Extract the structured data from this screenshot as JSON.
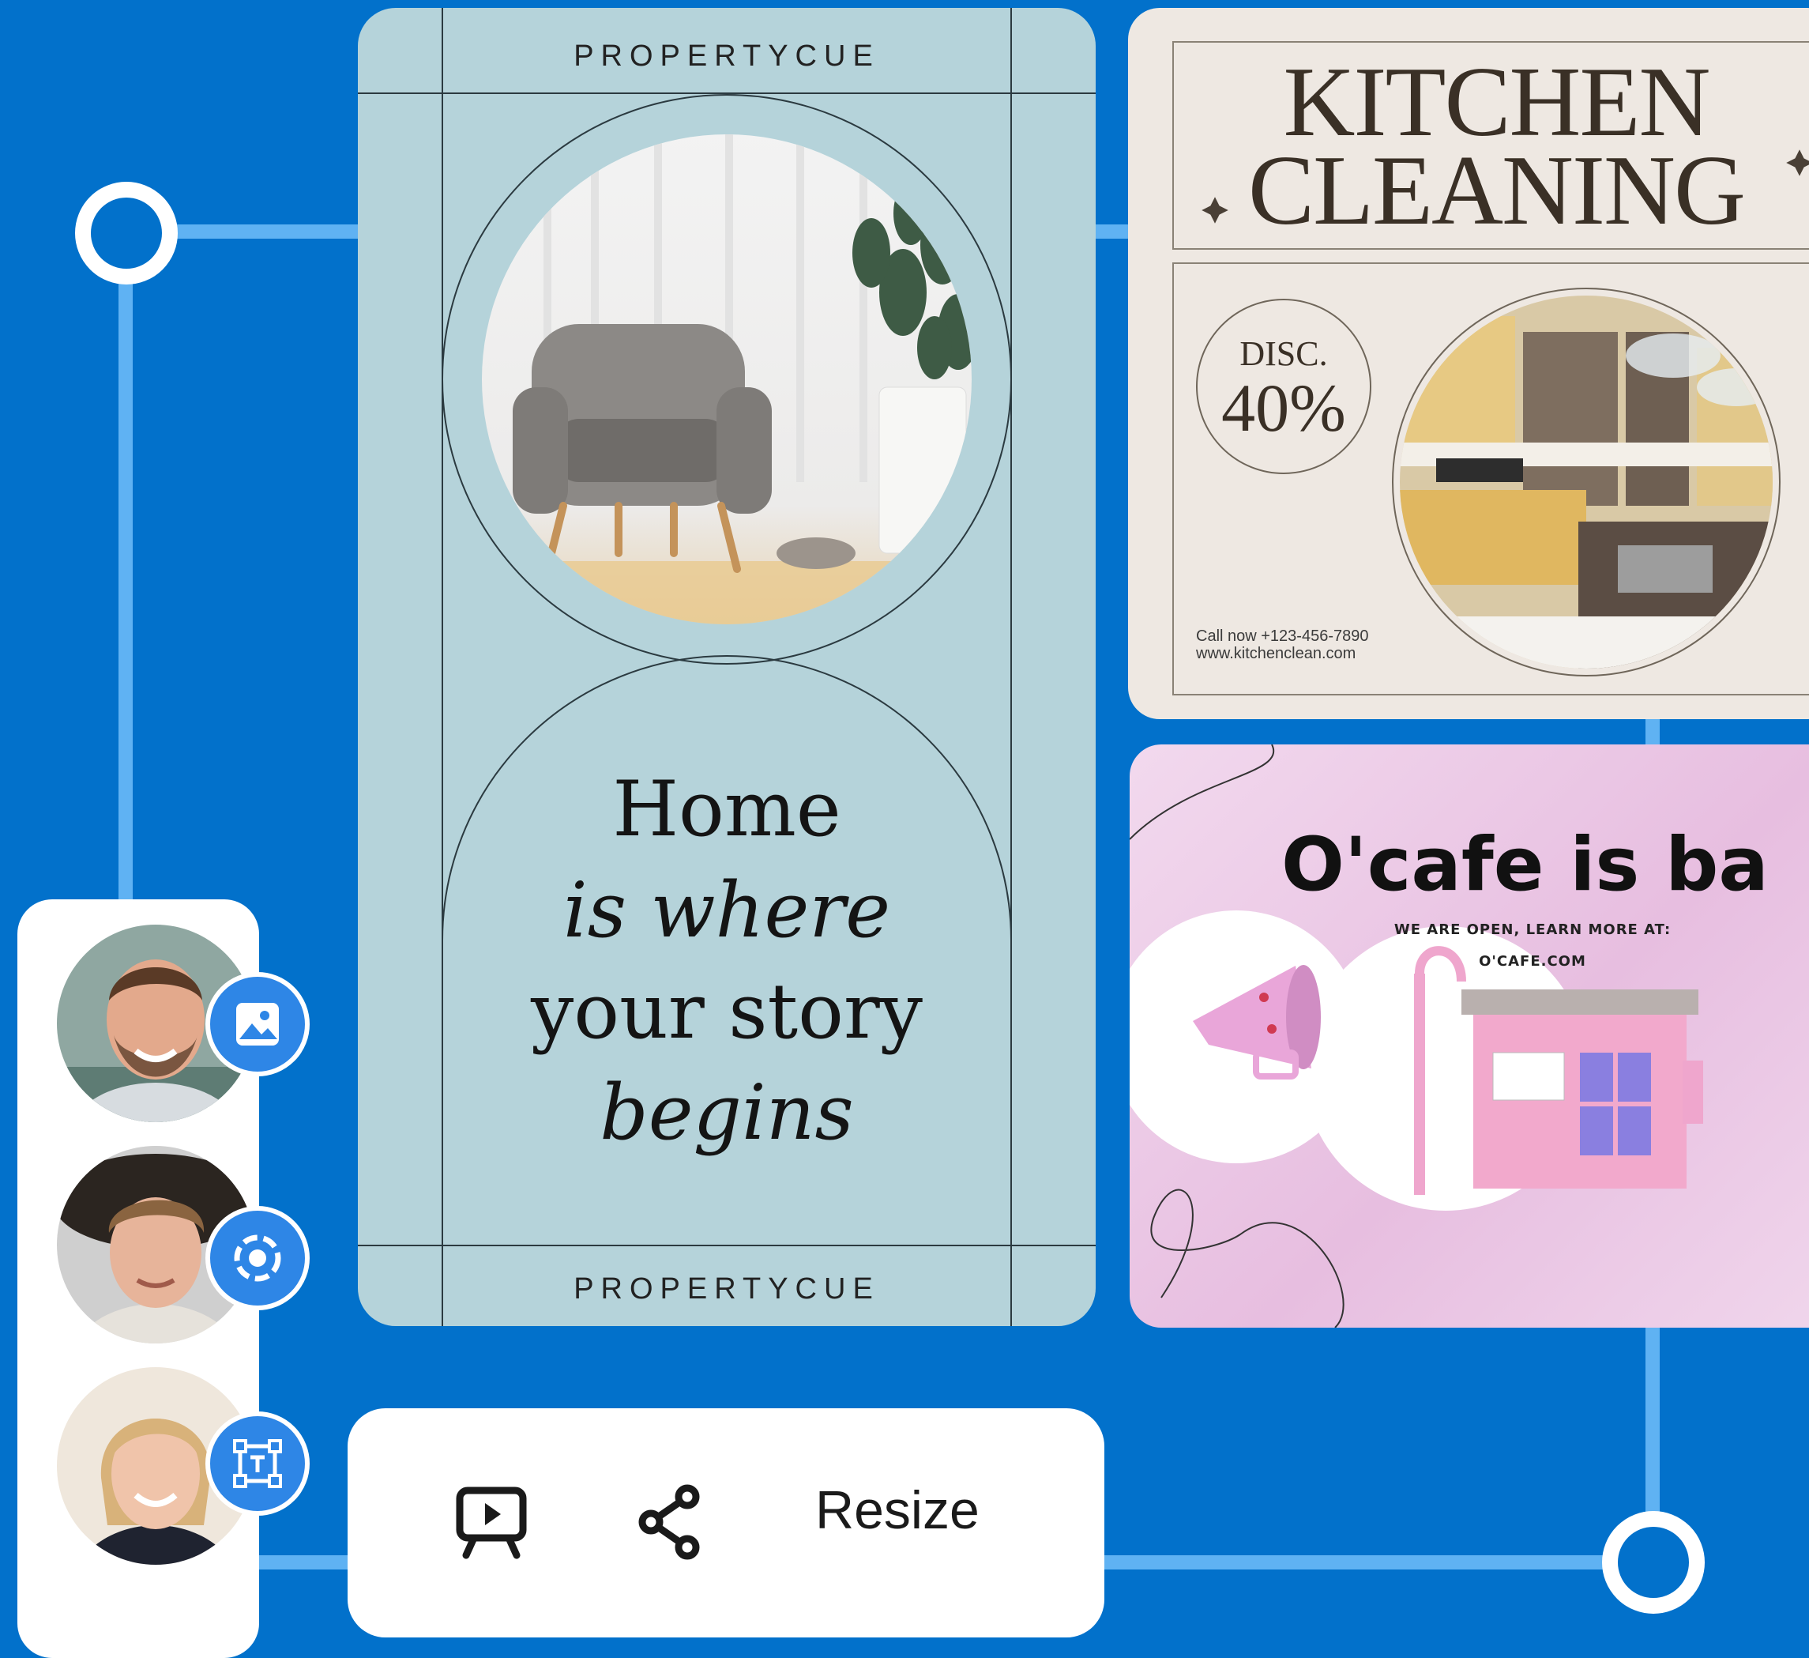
{
  "property_card": {
    "brand_top": "PROPERTYCUE",
    "brand_bottom": "PROPERTYCUE",
    "headline": [
      "Home",
      "is where",
      "your story",
      "begins"
    ]
  },
  "kitchen_card": {
    "title_line1": "KITCHEN",
    "title_line2": "CLEANING",
    "discount_label": "DISC.",
    "discount_value": "40%",
    "contact_line1": "Call now +123-456-7890",
    "contact_line2": "www.kitchenclean.com"
  },
  "cafe_card": {
    "title": "O'cafe is ba",
    "subtitle": "WE ARE OPEN, LEARN MORE AT:",
    "url": "O'CAFE.COM"
  },
  "toolbar": {
    "present_icon": "presentation-play-icon",
    "share_icon": "share-icon",
    "resize_label": "Resize"
  },
  "avatar_panel": {
    "items": [
      {
        "avatar": "avatar-man-beard",
        "badge_icon": "image-icon"
      },
      {
        "avatar": "avatar-man-hat",
        "badge_icon": "focus-target-icon"
      },
      {
        "avatar": "avatar-woman-blonde",
        "badge_icon": "text-box-icon"
      }
    ]
  },
  "colors": {
    "background": "#0271CB",
    "connector": "#5FB2F3",
    "badge": "#2E86E6",
    "property_card": "#B5D3DA",
    "kitchen_card": "#EEE8E2"
  }
}
